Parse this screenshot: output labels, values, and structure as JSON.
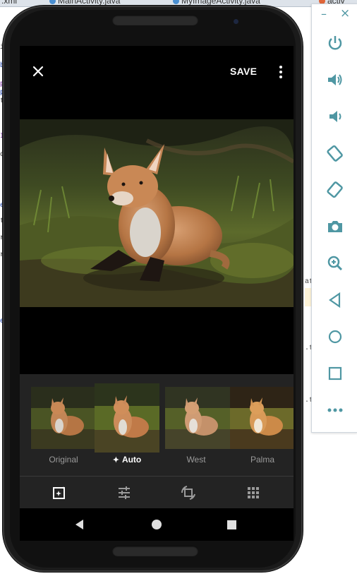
{
  "ide": {
    "tabs": [
      {
        "label": "MainActivity.java"
      },
      {
        "label": "MyImageActivity.java"
      },
      {
        "label": "activ"
      }
    ],
    "left_tab_fragment": ".xml"
  },
  "app": {
    "close_icon": "close-icon",
    "save_label": "SAVE",
    "more_icon": "more-vert-icon"
  },
  "filters": [
    {
      "label": "Original",
      "selected": false
    },
    {
      "label": "Auto",
      "selected": true,
      "icon": "auto-sparkle-icon"
    },
    {
      "label": "West",
      "selected": false
    },
    {
      "label": "Palma",
      "selected": false
    }
  ],
  "toolbar": {
    "items": [
      "auto-enhance-icon",
      "tune-sliders-icon",
      "rotate-crop-icon",
      "grid-icon"
    ]
  },
  "navbar": {
    "items": [
      "back-icon",
      "home-icon",
      "recents-icon"
    ]
  },
  "emulator": {
    "minimize_label": "–",
    "close_label": "×",
    "buttons": [
      "power-icon",
      "volume-up-icon",
      "volume-down-icon",
      "rotate-left-icon",
      "rotate-right-icon",
      "camera-icon",
      "zoom-icon",
      "back-icon",
      "home-icon",
      "overview-icon",
      "more-horiz-icon"
    ]
  },
  "colors": {
    "screen_bg": "#000000",
    "panel_bg": "#232323",
    "emulator_icon": "#4f97a3"
  }
}
